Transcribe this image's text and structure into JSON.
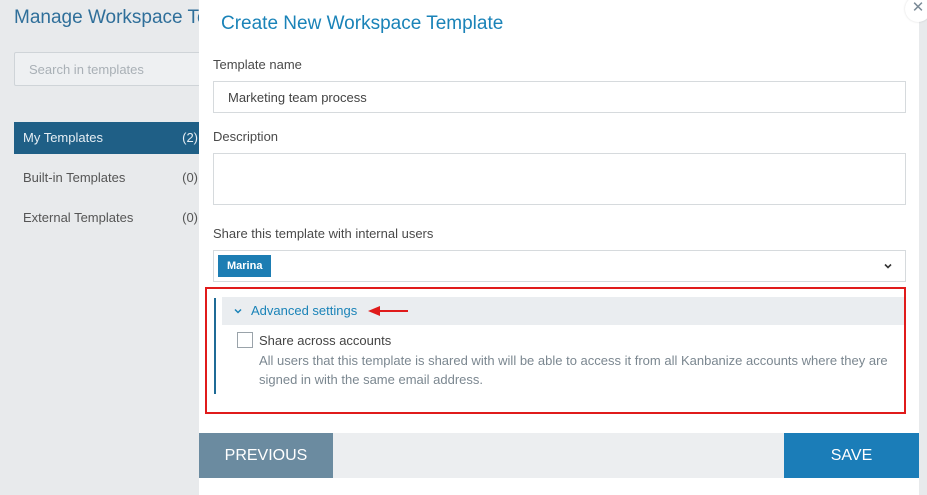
{
  "background": {
    "title": "Manage Workspace Te",
    "search_placeholder": "Search in templates",
    "nav": [
      {
        "label": "My Templates",
        "count": "(2)"
      },
      {
        "label": "Built-in Templates",
        "count": "(0)"
      },
      {
        "label": "External Templates",
        "count": "(0)"
      }
    ]
  },
  "modal": {
    "title": "Create New Workspace Template",
    "template_name_label": "Template name",
    "template_name_value": "Marketing team process",
    "description_label": "Description",
    "description_value": "",
    "share_label": "Share this template with internal users",
    "shared_users": [
      "Marina"
    ],
    "advanced": {
      "label": "Advanced settings",
      "checkbox_label": "Share across accounts",
      "checkbox_checked": false,
      "help_text": "All users that this template is shared with will be able to access it from all Kanbanize accounts where they are signed in with the same email address."
    },
    "footer": {
      "previous_label": "PREVIOUS",
      "save_label": "SAVE"
    }
  },
  "colors": {
    "accent": "#1a83b8",
    "highlight_border": "#e01b1b",
    "nav_active": "#1f5f86",
    "save_button": "#1b7db8",
    "previous_button": "#6b8ba0"
  }
}
